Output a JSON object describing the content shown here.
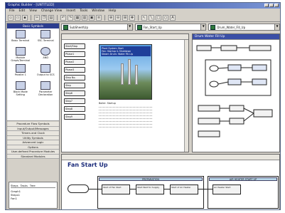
{
  "window": {
    "title": "Graphic Builder - [UNTITLED]"
  },
  "menu": [
    "File",
    "Edit",
    "View",
    "Change View",
    "Insert",
    "Tools",
    "Window",
    "Help"
  ],
  "palette": {
    "header": "Basic Symbols",
    "items": [
      {
        "label": "Basic Terminal",
        "icon": "terminal-icon"
      },
      {
        "label": "SSC Terminal",
        "icon": "terminal-icon"
      },
      {
        "label": "Module Graph/Terminal",
        "icon": "module-icon"
      },
      {
        "label": "AND",
        "icon": "and-gate-icon"
      },
      {
        "label": "Parallel 1",
        "icon": "parallel-icon"
      },
      {
        "label": "Output to SCS",
        "icon": "output-icon"
      },
      {
        "label": "Block Mode Setting",
        "icon": "block-mode-icon"
      },
      {
        "label": "Parameter Declaration",
        "icon": "parameter-icon"
      }
    ],
    "sections": [
      "Procedure Flow Symbols",
      "Input/Output/Messages",
      "Timers and Clock",
      "Utility Symbols",
      "Advanced Logic",
      "Options",
      "User-defined Procedure Modules",
      "Standard Modules"
    ],
    "bottom_tabs": [
      "Steps",
      "Tasks",
      "Tree"
    ],
    "bottom_items": [
      "Graph1",
      "Steps1",
      "Fan1"
    ]
  },
  "documents": [
    "SubSheet\\Up",
    "Fan_Start_Up",
    "Drum_Water_Fill_Up"
  ],
  "left_pane": {
    "buttons": [
      "Start/Stop",
      "Phase1",
      "Phase2",
      "Phase3",
      "Step No.",
      "Step",
      "Step6",
      "Step7",
      "Step8",
      "Step9"
    ],
    "doc_lines": [
      "Plant System Start",
      "Fan: Startup & Shutdown",
      "Steam Drum: Water Fill-Up",
      "Boiler: Startup"
    ]
  },
  "right_pane": {
    "title": "Drum Water Fill Up"
  },
  "bottom_pane": {
    "title": "Fan Start Up",
    "stage_a": "PREPARATION",
    "stage_b": "AIR HEATER START UP",
    "boxes": [
      "Start of Fan Start",
      "Start Wait for Supply",
      "Start of Air Heater",
      "Air Heater Start"
    ]
  },
  "colors": {
    "titlebar": "#1d2f86",
    "pane_header": "#3b4fa6",
    "stage_head": "#b8d6ea"
  }
}
